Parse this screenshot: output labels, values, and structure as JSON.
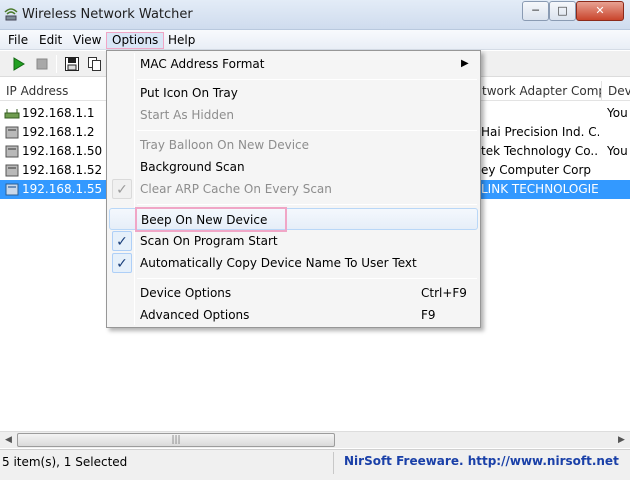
{
  "window": {
    "title": "Wireless Network Watcher",
    "min": "─",
    "max": "□",
    "close": "✕"
  },
  "menubar": {
    "file": "File",
    "edit": "Edit",
    "view": "View",
    "options": "Options",
    "help": "Help"
  },
  "list": {
    "headers": {
      "ip": "IP Address",
      "vendor": "twork Adapter Comp...",
      "dev": "Dev"
    },
    "rows": [
      {
        "ip": "192.168.1.1",
        "vendor": "",
        "dev": "You",
        "selected": false
      },
      {
        "ip": "192.168.1.2",
        "vendor": "Hai Precision Ind. C...",
        "dev": "",
        "selected": false
      },
      {
        "ip": "192.168.1.50",
        "vendor": "tek Technology Co....",
        "dev": "You",
        "selected": false
      },
      {
        "ip": "192.168.1.52",
        "vendor": "ey Computer Corp",
        "dev": "",
        "selected": false
      },
      {
        "ip": "192.168.1.55",
        "vendor": "LINK TECHNOLOGIE...",
        "dev": "",
        "selected": true
      }
    ]
  },
  "options_menu": {
    "mac_format": "MAC Address Format",
    "put_icon_tray": "Put Icon On Tray",
    "start_hidden": "Start As Hidden",
    "tray_balloon": "Tray Balloon On New Device",
    "background_scan": "Background Scan",
    "clear_arp": "Clear ARP Cache On Every Scan",
    "beep_new_device": "Beep On New Device",
    "scan_on_start": "Scan On Program Start",
    "auto_copy_name": "Automatically Copy Device Name To User Text",
    "device_options": "Device Options",
    "device_options_shortcut": "Ctrl+F9",
    "advanced_options": "Advanced Options",
    "advanced_options_shortcut": "F9",
    "submenu_arrow": "▶",
    "check_mark": "✓"
  },
  "statusbar": {
    "count": "5 item(s), 1 Selected",
    "link": "NirSoft Freeware.  http://www.nirsoft.net"
  },
  "scrollbar": {
    "left": "◀",
    "right": "▶",
    "grip": "|||"
  },
  "colors": {
    "selection": "#3399ff",
    "link": "#1a40a8",
    "highlight": "#f0a6c6"
  }
}
